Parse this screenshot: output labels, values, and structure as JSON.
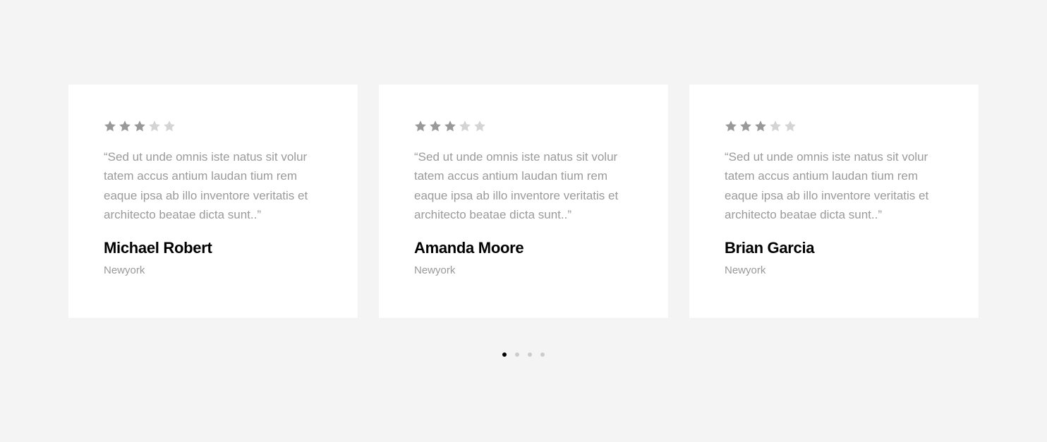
{
  "colors": {
    "star_filled": "#999999",
    "star_empty": "#d4d4d4",
    "dot_active": "#000000",
    "dot_inactive": "#cccccc"
  },
  "testimonials": [
    {
      "rating": 3,
      "max_rating": 5,
      "quote": "“Sed ut unde omnis iste natus sit volur tatem accus antium laudan tium rem eaque ipsa ab illo inventore veritatis et architecto beatae dicta sunt..”",
      "name": "Michael Robert",
      "location": "Newyork"
    },
    {
      "rating": 3,
      "max_rating": 5,
      "quote": "“Sed ut unde omnis iste natus sit volur tatem accus antium laudan tium rem eaque ipsa ab illo inventore veritatis et architecto beatae dicta sunt..”",
      "name": "Amanda Moore",
      "location": "Newyork"
    },
    {
      "rating": 3,
      "max_rating": 5,
      "quote": "“Sed ut unde omnis iste natus sit volur tatem accus antium laudan tium rem eaque ipsa ab illo inventore veritatis et architecto beatae dicta sunt..”",
      "name": "Brian Garcia",
      "location": "Newyork"
    }
  ],
  "pagination": {
    "pages": 4,
    "active": 1
  }
}
